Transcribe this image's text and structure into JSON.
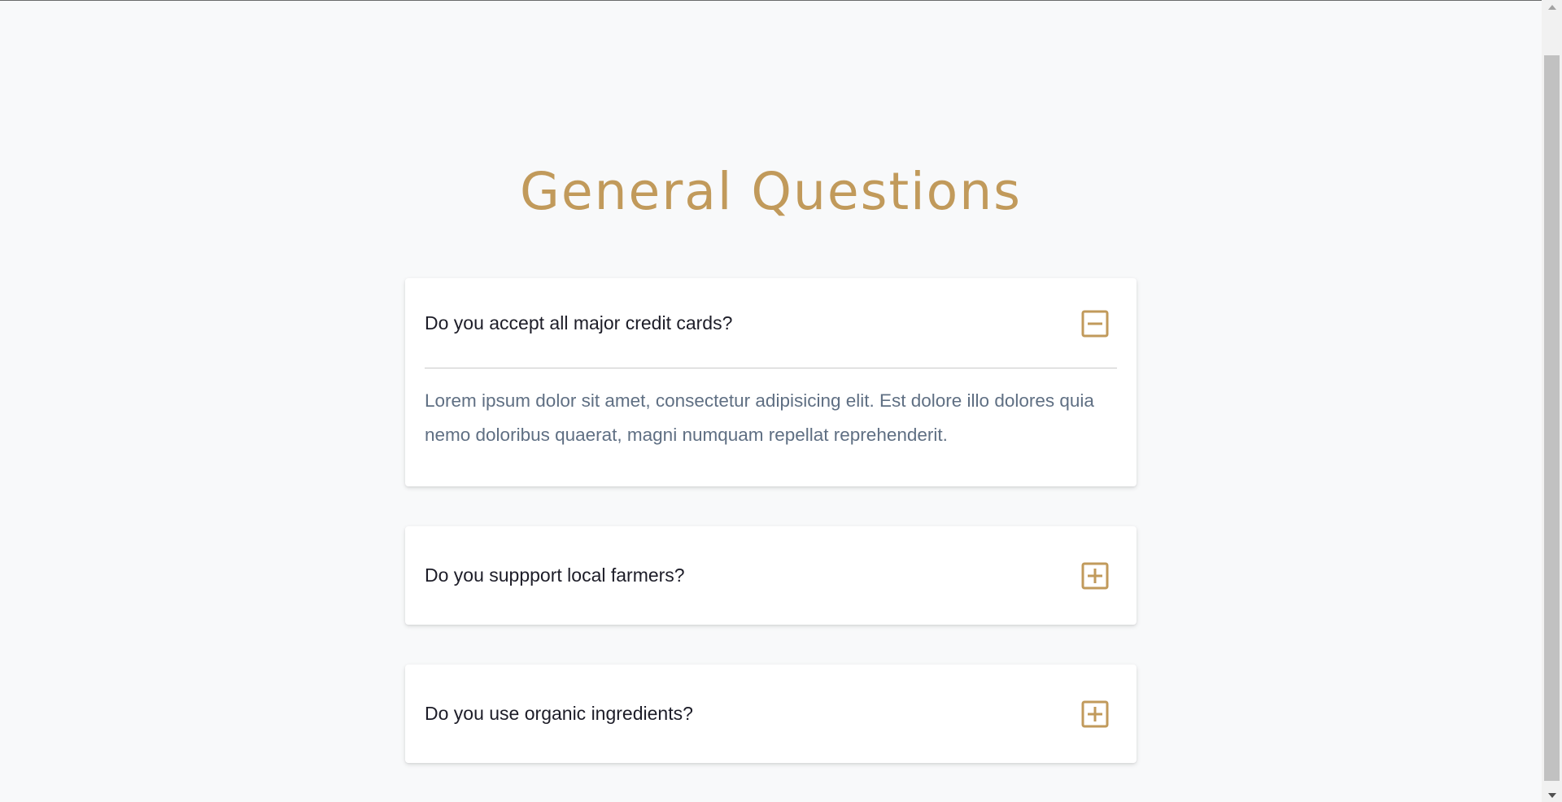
{
  "page": {
    "title": "General Questions"
  },
  "faq": [
    {
      "question": "Do you accept all major credit cards?",
      "answer": "Lorem ipsum dolor sit amet, consectetur adipisicing elit. Est dolore illo dolores quia nemo doloribus quaerat, magni numquam repellat reprehenderit.",
      "expanded": true,
      "icon": "minus-square-icon"
    },
    {
      "question": "Do you suppport local farmers?",
      "expanded": false,
      "icon": "plus-square-icon"
    },
    {
      "question": "Do you use organic ingredients?",
      "expanded": false,
      "icon": "plus-square-icon"
    }
  ],
  "colors": {
    "accent": "#c19a5b",
    "background": "#f8f9fa",
    "card": "#ffffff",
    "question_text": "#1d1d28",
    "answer_text": "#5f6f83"
  }
}
